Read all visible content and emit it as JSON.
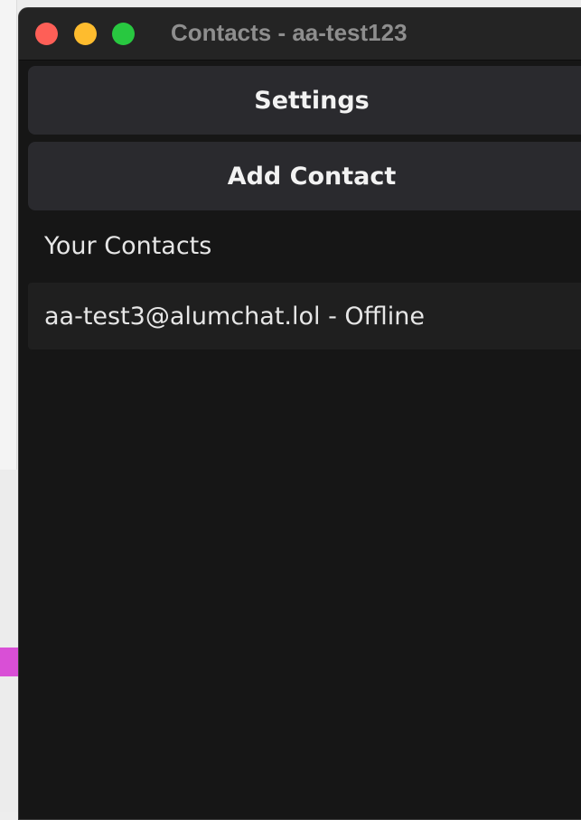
{
  "window": {
    "title": "Contacts - aa-test123"
  },
  "actions": {
    "settings_label": "Settings",
    "add_contact_label": "Add Contact"
  },
  "contacts": {
    "heading": "Your Contacts",
    "items": [
      {
        "label": "aa-test3@alumchat.lol - Offline"
      }
    ]
  },
  "colors": {
    "close": "#fe5f57",
    "minimize": "#febc2e",
    "maximize": "#28c840",
    "window_bg": "#161616",
    "button_bg": "#2a2a2e"
  }
}
